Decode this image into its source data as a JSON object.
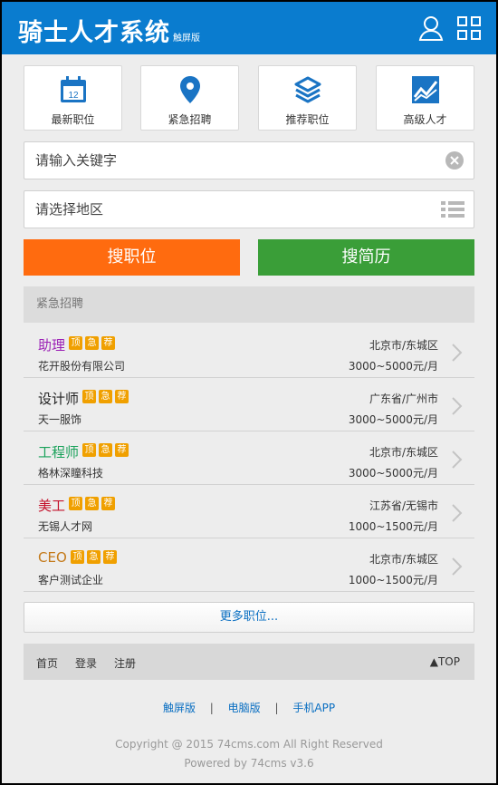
{
  "header": {
    "title": "骑士人才系统",
    "subtitle": "触屏版",
    "icons": [
      "user-icon",
      "grid-icon"
    ]
  },
  "quick_nav": [
    {
      "label": "最新职位",
      "icon": "calendar-icon",
      "calendar_number": "12"
    },
    {
      "label": "紧急招聘",
      "icon": "map-pin-icon"
    },
    {
      "label": "推荐职位",
      "icon": "layers-icon"
    },
    {
      "label": "高级人才",
      "icon": "trend-chart-icon"
    }
  ],
  "search": {
    "keyword_placeholder": "请输入关键字",
    "region_placeholder": "请选择地区",
    "search_jobs_label": "搜职位",
    "search_resumes_label": "搜简历"
  },
  "urgent": {
    "heading": "紧急招聘",
    "tag_labels": [
      "顶",
      "急",
      "荐"
    ],
    "jobs": [
      {
        "title": "助理",
        "title_color": "#9b1fb5",
        "company": "花开股份有限公司",
        "location": "北京市/东城区",
        "salary": "3000~5000元/月"
      },
      {
        "title": "设计师",
        "title_color": "#222222",
        "company": "天一服饰",
        "location": "广东省/广州市",
        "salary": "3000~5000元/月"
      },
      {
        "title": "工程师",
        "title_color": "#19a15a",
        "company": "格林深瞳科技",
        "location": "北京市/东城区",
        "salary": "3000~5000元/月"
      },
      {
        "title": "美工",
        "title_color": "#c4122c",
        "company": "无锡人才网",
        "location": "江苏省/无锡市",
        "salary": "1000~1500元/月"
      },
      {
        "title": "CEO",
        "title_color": "#c47a1a",
        "company": "客户测试企业",
        "location": "北京市/东城区",
        "salary": "1000~1500元/月"
      }
    ],
    "more_label": "更多职位..."
  },
  "footer": {
    "nav": [
      "首页",
      "登录",
      "注册"
    ],
    "top_label": "▲TOP",
    "links": [
      "触屏版",
      "电脑版",
      "手机APP"
    ],
    "separator": "|",
    "copyright": "Copyright @ 2015 74cms.com All Right Reserved",
    "powered": "Powered by 74cms v3.6"
  },
  "colors": {
    "header_bg": "#0a7ccf",
    "accent_blue": "#0a6fc2",
    "orange": "#ff6b0f",
    "green": "#3a9e38",
    "tag": "#f0a000"
  }
}
